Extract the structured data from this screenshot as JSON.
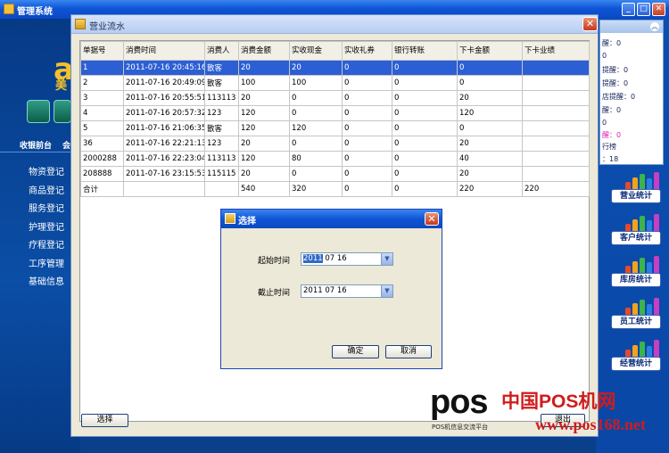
{
  "main_window": {
    "title": "管理系统"
  },
  "left_nav": {
    "logo_text": "美",
    "tabs": [
      "收银前台",
      "会"
    ],
    "items": [
      "物资登记",
      "商品登记",
      "服务登记",
      "护理登记",
      "疗程登记",
      "工序管理",
      "基础信息"
    ]
  },
  "right_panel": {
    "lines": [
      {
        "text": "醒：0",
        "pink": false
      },
      {
        "text": "0",
        "pink": false
      },
      {
        "text": "提醒：0",
        "pink": false
      },
      {
        "text": "提醒：0",
        "pink": false
      },
      {
        "text": "店提醒：0",
        "pink": false
      },
      {
        "text": "醒：0",
        "pink": false
      },
      {
        "text": "0",
        "pink": false
      },
      {
        "text": "醒：0",
        "pink": true
      },
      {
        "text": "行榜",
        "pink": false
      },
      {
        "text": "：18",
        "pink": false
      }
    ],
    "stat_buttons": [
      "营业统计",
      "客户统计",
      "库房统计",
      "员工统计",
      "经营统计"
    ],
    "collapse_icon": "double-chevron-up-icon"
  },
  "flow_window": {
    "title": "营业流水",
    "columns": [
      "单据号",
      "消费时间",
      "消费人",
      "消费金额",
      "实收现金",
      "实收礼券",
      "银行转账",
      "下卡金额",
      "下卡业绩"
    ],
    "rows": [
      [
        "1",
        "2011-07-16 20:45:16",
        "散客",
        "20",
        "20",
        "0",
        "0",
        "0",
        ""
      ],
      [
        "2",
        "2011-07-16 20:49:09",
        "散客",
        "100",
        "100",
        "0",
        "0",
        "0",
        ""
      ],
      [
        "3",
        "2011-07-16 20:55:51",
        "113113",
        "20",
        "0",
        "0",
        "0",
        "20",
        ""
      ],
      [
        "4",
        "2011-07-16 20:57:32",
        "123",
        "120",
        "0",
        "0",
        "0",
        "120",
        ""
      ],
      [
        "5",
        "2011-07-16 21:06:35",
        "散客",
        "120",
        "120",
        "0",
        "0",
        "0",
        ""
      ],
      [
        "36",
        "2011-07-16 22:21:13",
        "123",
        "20",
        "0",
        "0",
        "0",
        "20",
        ""
      ],
      [
        "2000288",
        "2011-07-16 22:23:04",
        "113113",
        "120",
        "80",
        "0",
        "0",
        "40",
        ""
      ],
      [
        "208888",
        "2011-07-16 23:15:53",
        "115115",
        "20",
        "0",
        "0",
        "0",
        "20",
        ""
      ]
    ],
    "total_row": [
      "合计",
      "",
      "",
      "540",
      "320",
      "0",
      "0",
      "220",
      "220"
    ],
    "select_button": "选择",
    "exit_button": "退出"
  },
  "select_dialog": {
    "title": "选择",
    "start_label": "起始时间",
    "start_year": "2011",
    "start_rest": " 07 16",
    "end_label": "截止时间",
    "end_value": "2011 07 16",
    "ok_button": "确定",
    "cancel_button": "取消"
  },
  "watermark": {
    "brand": "pos",
    "cn_text": "中国POS机网",
    "url": "www.pos168.net",
    "small_text": "POS机信息交流平台"
  }
}
